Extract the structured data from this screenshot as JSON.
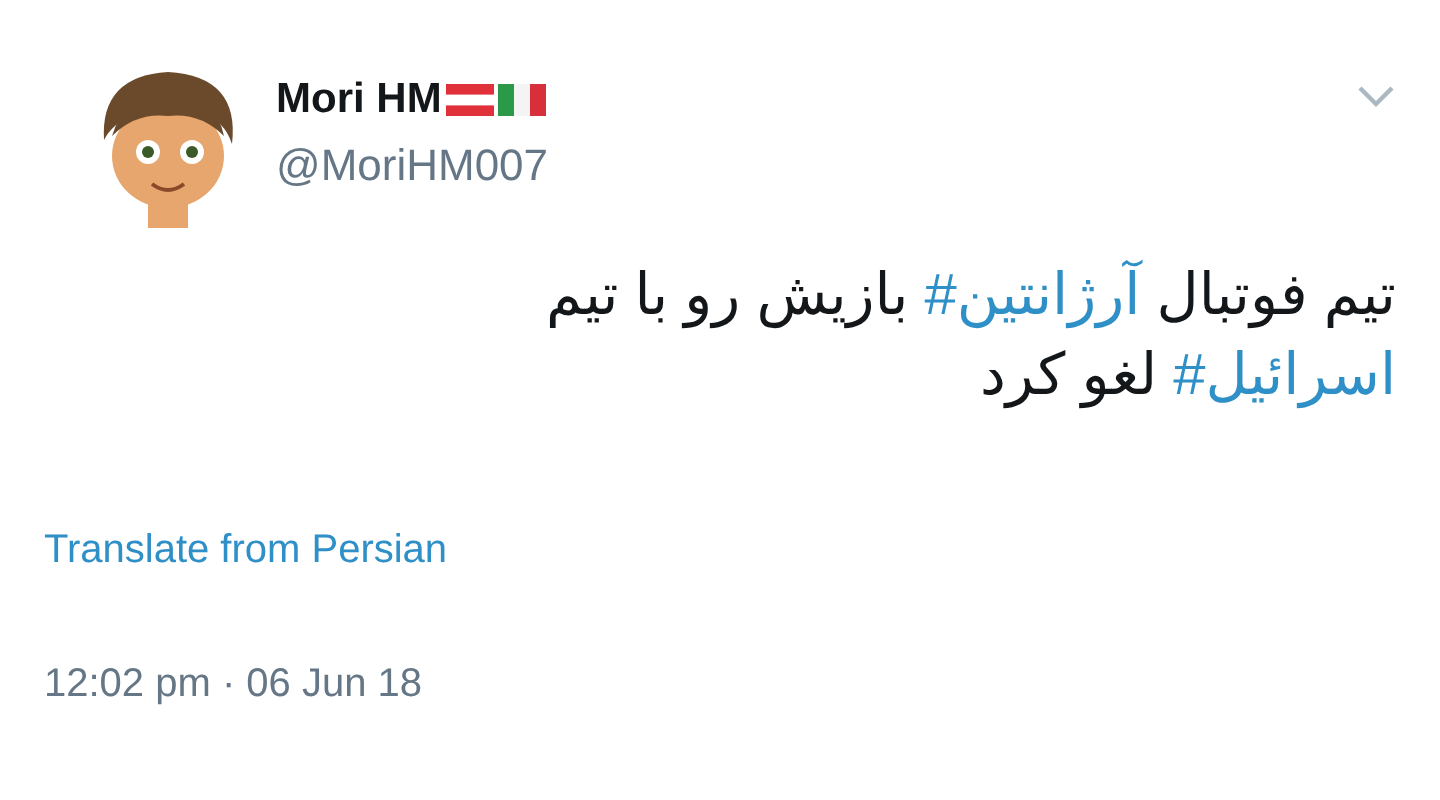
{
  "author": {
    "name": "Mori HM",
    "handle": "@MoriHM007"
  },
  "tweet": {
    "lines": [
      [
        {
          "kind": "text",
          "text": "تیم فوتبال "
        },
        {
          "kind": "hashtag",
          "text": "#آرژانتین"
        },
        {
          "kind": "text",
          "text": " بازیش رو با تیم"
        }
      ],
      [
        {
          "kind": "hashtag",
          "text": "#اسرائیل"
        },
        {
          "kind": "text",
          "text": " لغو کرد"
        }
      ]
    ]
  },
  "translate_link": "Translate from Persian",
  "timestamp": "12:02 pm · 06 Jun 18"
}
